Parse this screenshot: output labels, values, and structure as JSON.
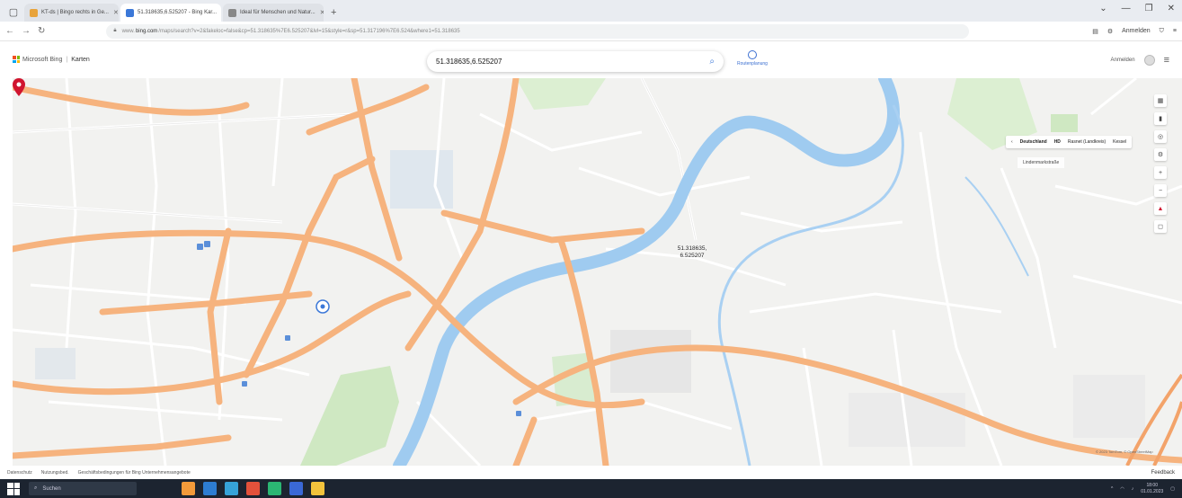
{
  "browser": {
    "tabs": [
      {
        "label": "KT-ds | Bingo rechts in Ge...",
        "active": false,
        "color": "#e8a33a"
      },
      {
        "label": "51.318635,6.525207 - Bing Kar...",
        "active": true,
        "color": "#3b78d8"
      },
      {
        "label": "Ideal für Menschen und Natur...",
        "active": false,
        "color": "#888888"
      }
    ],
    "url_prefix": "www.",
    "url_host": "bing.com",
    "url_rest": "/maps/search?v=2&fakeloc=false&cp=51.318635%7E6.525207&lvl=15&style=r&sp=51.317196%7E6.524&where1=51.318635"
  },
  "app": {
    "brand_name": "Microsoft Bing",
    "section": "Karten",
    "search_value": "51.318635,6.525207",
    "route_label": "Routenplanung",
    "signin_label": "Anmelden"
  },
  "map": {
    "pin_label_line1": "51.318635,",
    "pin_label_line2": "6.525207",
    "layers": [
      {
        "label": "Deutschland",
        "active": true
      },
      {
        "label": "HD",
        "active": true
      },
      {
        "label": "Rasnet (Landkreis)",
        "active": false
      },
      {
        "label": "Kessel",
        "active": false
      }
    ],
    "street_chip": "Lindenmarkstraße",
    "scale_label": "© 2023 TomTom, © OpenStreetMap"
  },
  "footer": {
    "links": [
      "Datenschutz",
      "Nutzungsbed.",
      "Geschäftsbedingungen für Bing Unternehmensangebote"
    ],
    "feedback": "Feedback"
  },
  "taskbar": {
    "search_placeholder": "Suchen",
    "time": "18:00",
    "date": "01.01.2023",
    "apps": [
      "#f29a3a",
      "#2d7dd2",
      "#36a3d9",
      "#e2513b",
      "#2bb673",
      "#3a68d6",
      "#f3c33c"
    ]
  },
  "colors": {
    "water": "#9fcbf0",
    "major_road": "#f6b37e",
    "minor_road": "#ffffff",
    "park": "#cfe8c2",
    "pin": "#d0152f"
  }
}
